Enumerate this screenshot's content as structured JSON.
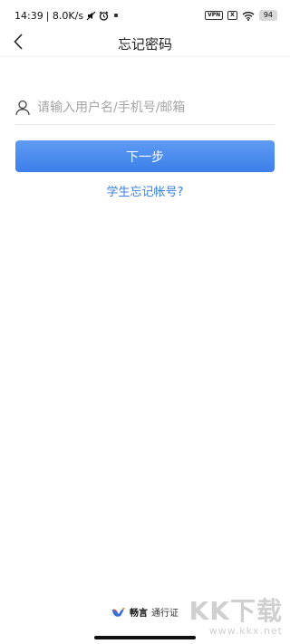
{
  "status_bar": {
    "time": "14:39",
    "network_speed": "| 8.0K/s",
    "vpn_label": "VPN",
    "x_label": "X",
    "battery": "94"
  },
  "header": {
    "title": "忘记密码",
    "back_icon": "chevron-left-icon"
  },
  "form": {
    "account_placeholder": "请输入用户名/手机号/邮箱",
    "account_value": "",
    "next_button_label": "下一步",
    "forgot_student_link": "学生忘记帐号?"
  },
  "footer": {
    "brand_name": "畅言",
    "brand_suffix": "通行证"
  },
  "watermark": {
    "text": "KK下载",
    "url": "www.kkx.net"
  },
  "colors": {
    "primary": "#3c7fe9",
    "link": "#3a7fe4",
    "placeholder": "#a5a5a5"
  }
}
